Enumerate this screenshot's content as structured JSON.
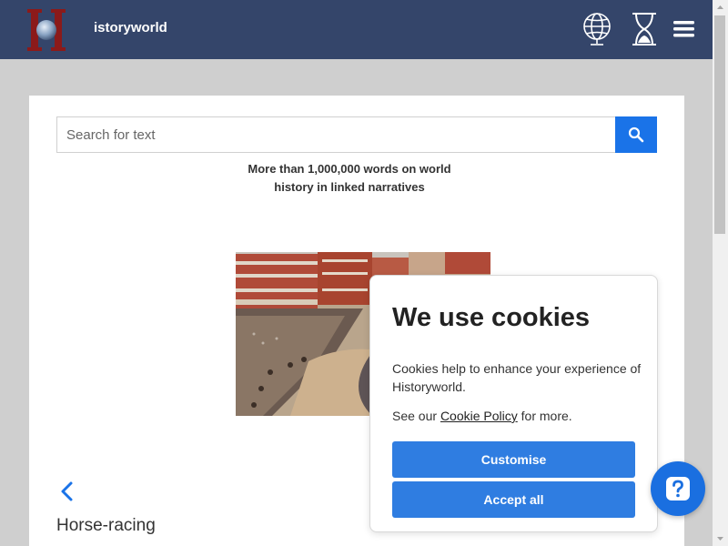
{
  "header": {
    "logo_letter": "H",
    "logo_text": "istoryworld",
    "icons": [
      "globe-icon",
      "hourglass-icon",
      "menu-icon"
    ],
    "background": "#34456a"
  },
  "search": {
    "placeholder": "Search for text",
    "value": "",
    "button_color": "#1a73e8",
    "icon": "search-icon"
  },
  "tagline": {
    "line1": "More than 1,000,000 words on world",
    "line2": "history in linked narratives"
  },
  "article": {
    "title": "Horse-racing",
    "back_icon": "chevron-left-icon"
  },
  "cookie_banner": {
    "title": "We use cookies",
    "text": "Cookies help to enhance your experience of Historyworld.",
    "see_prefix": "See our ",
    "policy_link": "Cookie Policy",
    "see_suffix": " for more.",
    "customise_label": "Customise",
    "accept_label": "Accept all",
    "button_color": "#2f7de1"
  },
  "help": {
    "icon": "question-icon",
    "color": "#1a6fe0"
  }
}
